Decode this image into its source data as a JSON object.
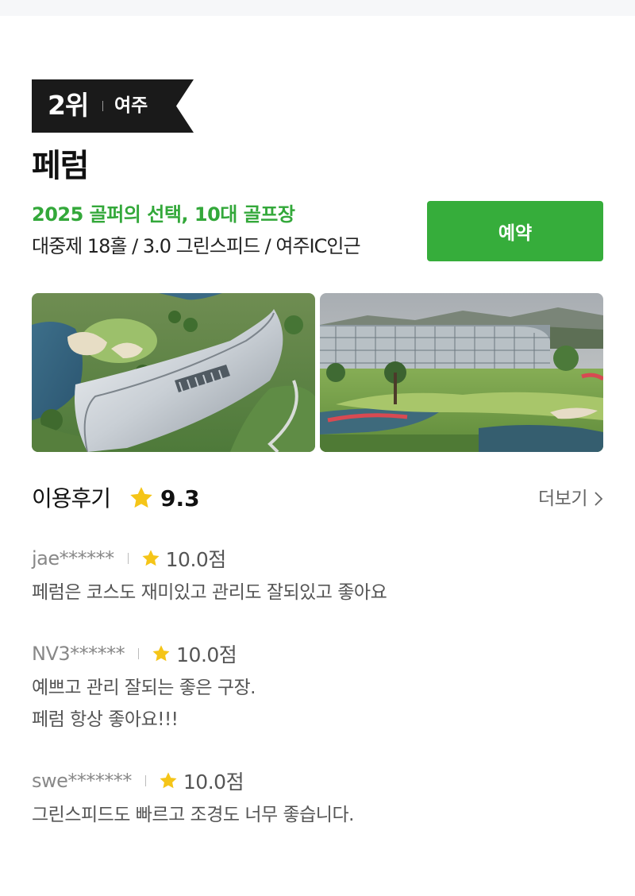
{
  "rank": {
    "label": "2위",
    "region": "여주"
  },
  "course": {
    "name": "페럼",
    "award": "2025 골퍼의 선택, 10대 골프장",
    "info": "대중제 18홀 / 3.0 그린스피드 / 여주IC인근"
  },
  "reserve_button": "예약",
  "photos": [
    {
      "alt": "aerial-clubhouse-photo"
    },
    {
      "alt": "clubhouse-and-green-photo"
    }
  ],
  "reviews_section": {
    "title": "이용후기",
    "rating": "9.3",
    "more_label": "더보기"
  },
  "reviews": [
    {
      "user": "jae******",
      "score": "10.0점",
      "text": "페럼은 코스도 재미있고 관리도 잘되있고 좋아요"
    },
    {
      "user": "NV3******",
      "score": "10.0점",
      "text": "예쁘고 관리 잘되는 좋은 구장.\n페럼 항상 좋아요!!!"
    },
    {
      "user": "swe*******",
      "score": "10.0점",
      "text": "그린스피드도 빠르고 조경도 너무 좋습니다."
    }
  ],
  "colors": {
    "brand_green": "#36ad3b",
    "award_green": "#33a83a",
    "badge_black": "#1a1a1a",
    "star_yellow": "#f5c518"
  },
  "icons": [
    "star-icon",
    "chevron-right-icon"
  ]
}
